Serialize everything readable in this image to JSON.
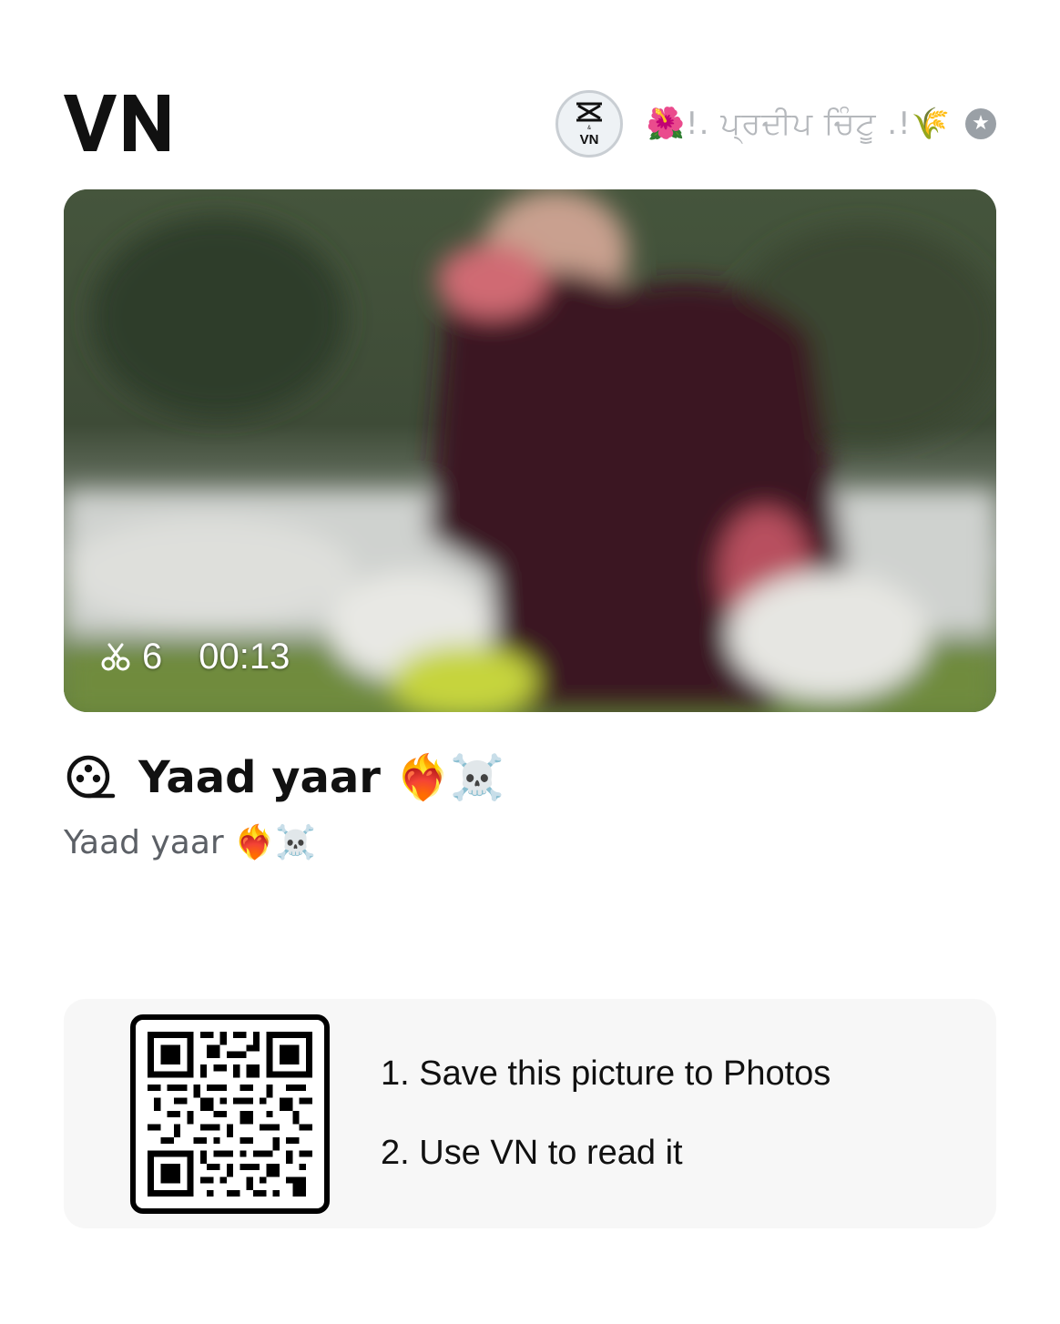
{
  "header": {
    "logo_text": "VN",
    "author_name": "🌺!. ਪ੍ਰਦੀਪ ਚਿੰਟੂ .!🌾",
    "avatar_icon": "capcut-vn-avatar",
    "badge_icon": "star-badge-icon"
  },
  "video": {
    "clip_count": "6",
    "duration": "00:13"
  },
  "project": {
    "title": "Yaad yaar ❤️‍🔥☠️",
    "description": "Yaad yaar ❤️‍🔥☠️"
  },
  "qr_panel": {
    "step1": "1. Save this picture to Photos",
    "step2": "2. Use VN to read it"
  }
}
